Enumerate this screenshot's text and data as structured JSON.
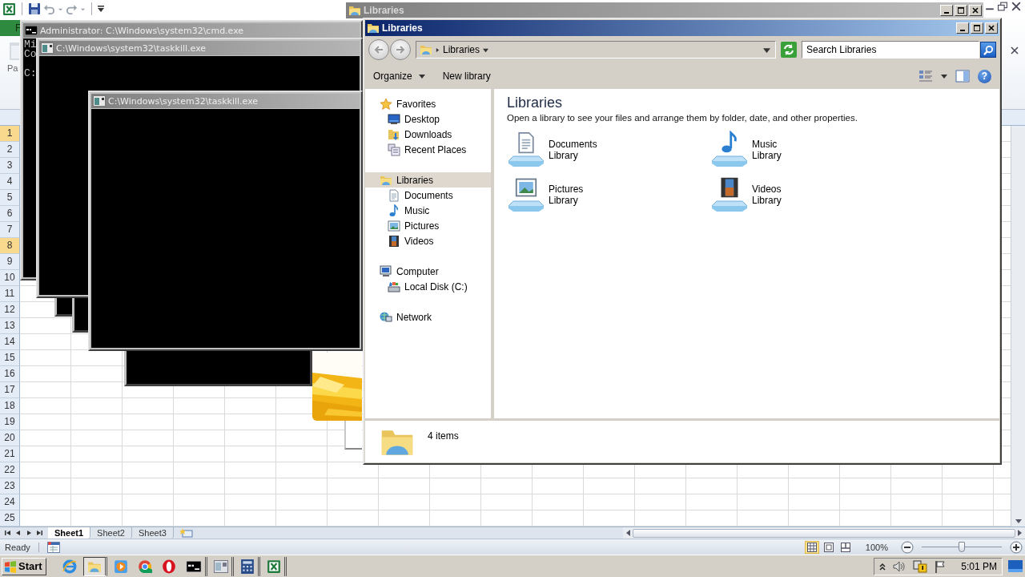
{
  "excel": {
    "file_tab": "F",
    "ribbon_label": "Pa",
    "row_headers": [
      {
        "label": "1",
        "selected": true
      },
      {
        "label": "2",
        "selected": false
      },
      {
        "label": "3",
        "selected": false
      },
      {
        "label": "4",
        "selected": false
      },
      {
        "label": "5",
        "selected": false
      },
      {
        "label": "6",
        "selected": false
      },
      {
        "label": "7",
        "selected": false
      },
      {
        "label": "8",
        "selected": true
      },
      {
        "label": "9",
        "selected": false
      },
      {
        "label": "10",
        "selected": false
      },
      {
        "label": "11",
        "selected": false
      },
      {
        "label": "12",
        "selected": false
      },
      {
        "label": "13",
        "selected": false
      },
      {
        "label": "14",
        "selected": false
      },
      {
        "label": "15",
        "selected": false
      },
      {
        "label": "16",
        "selected": false
      },
      {
        "label": "17",
        "selected": false
      },
      {
        "label": "18",
        "selected": false
      },
      {
        "label": "19",
        "selected": false
      },
      {
        "label": "20",
        "selected": false
      },
      {
        "label": "21",
        "selected": false
      },
      {
        "label": "22",
        "selected": false
      },
      {
        "label": "23",
        "selected": false
      },
      {
        "label": "24",
        "selected": false
      },
      {
        "label": "25",
        "selected": false
      }
    ],
    "sheet_tabs": [
      {
        "label": "Sheet1",
        "selected": true
      },
      {
        "label": "Sheet2",
        "selected": false
      },
      {
        "label": "Sheet3",
        "selected": false
      }
    ],
    "status": "Ready",
    "views": [
      {
        "kind": "normal",
        "selected": true
      },
      {
        "kind": "page_layout",
        "selected": false
      },
      {
        "kind": "page_break",
        "selected": false
      }
    ],
    "zoom": "100%",
    "zoom_slider": {
      "level": 0.5
    }
  },
  "console_windows": [
    {
      "title": "Administrator: C:\\Windows\\system32\\cmd.exe",
      "lines": [
        "Mi",
        "Co"
      ],
      "prompt": "C:"
    },
    {
      "title": "C:\\Windows\\system32\\taskkill.exe"
    },
    {
      "title": "C:\\Windows\\system32\\taskkill.exe"
    }
  ],
  "background_window": {
    "title": "Libraries"
  },
  "explorer": {
    "title": "Libraries",
    "address": "Libraries",
    "search_placeholder": "Search Libraries",
    "toolbar": [
      {
        "label": "Organize",
        "kind": "menu"
      },
      {
        "label": "New library",
        "kind": "plain"
      }
    ],
    "help": "?",
    "nav": [
      {
        "label": "Favorites",
        "kind": "favorites",
        "selected": false,
        "children": [
          {
            "label": "Desktop",
            "kind": "desktop",
            "selected": false
          },
          {
            "label": "Downloads",
            "kind": "downloads",
            "selected": false
          },
          {
            "label": "Recent Places",
            "kind": "recent",
            "selected": false
          }
        ]
      },
      {
        "label": "Libraries",
        "kind": "libraries",
        "selected": true,
        "children": [
          {
            "label": "Documents",
            "kind": "documents",
            "selected": false
          },
          {
            "label": "Music",
            "kind": "music",
            "selected": false
          },
          {
            "label": "Pictures",
            "kind": "pictures",
            "selected": false
          },
          {
            "label": "Videos",
            "kind": "videos",
            "selected": false
          }
        ]
      },
      {
        "label": "Computer",
        "kind": "computer",
        "selected": false,
        "children": [
          {
            "label": "Local Disk (C:)",
            "kind": "disk",
            "selected": false
          }
        ]
      },
      {
        "label": "Network",
        "kind": "network",
        "selected": false
      }
    ],
    "heading": "Libraries",
    "description": "Open a library to see your files and arrange them by folder, date, and other properties.",
    "libraries": [
      {
        "name": "Documents",
        "type": "Library",
        "kind": "documents"
      },
      {
        "name": "Music",
        "type": "Library",
        "kind": "music"
      },
      {
        "name": "Pictures",
        "type": "Library",
        "kind": "pictures"
      },
      {
        "name": "Videos",
        "type": "Library",
        "kind": "videos"
      }
    ],
    "item_count": "4 items"
  },
  "taskbar": {
    "start": "Start",
    "apps": [
      {
        "kind": "ie",
        "selected": false,
        "grouped": false
      },
      {
        "kind": "explorer",
        "selected": true,
        "grouped": true
      },
      {
        "kind": "media",
        "selected": false,
        "grouped": false
      },
      {
        "kind": "chrome",
        "selected": false,
        "grouped": false
      },
      {
        "kind": "opera",
        "selected": false,
        "grouped": false
      },
      {
        "kind": "cmd",
        "selected": false,
        "grouped": true
      },
      {
        "kind": "window",
        "selected": false,
        "grouped": true
      },
      {
        "kind": "calc",
        "selected": false,
        "grouped": true
      },
      {
        "kind": "excel",
        "selected": false,
        "grouped": true
      }
    ],
    "clock": "5:01 PM"
  }
}
